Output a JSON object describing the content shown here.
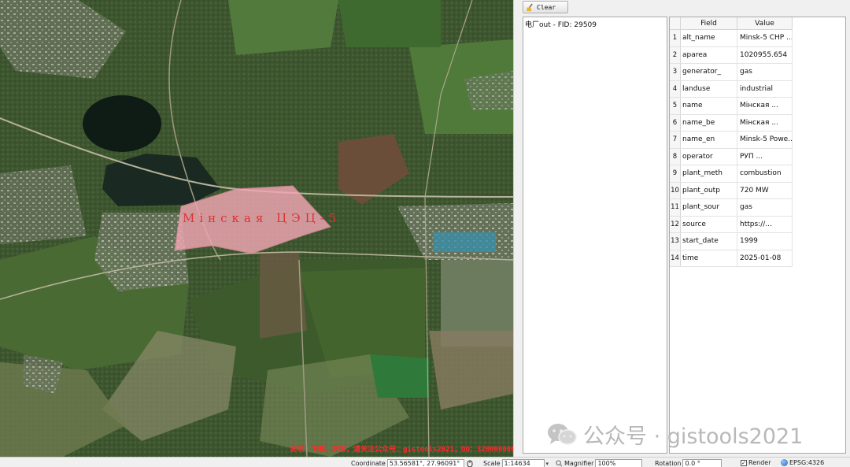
{
  "map": {
    "place_label": "Мінская ЦЭЦ-5",
    "watermark": "说明：下载、封装，请关注公众号：gistools2021，QQ：3200000000"
  },
  "identify_panel": {
    "clear_button": "Clear",
    "tree_item": "电厂out - FID: 29509"
  },
  "attribute_table": {
    "headers": {
      "field": "Field",
      "value": "Value"
    },
    "rows": [
      {
        "idx": "1",
        "field": "alt_name",
        "value": "Minsk-5 CHP ..."
      },
      {
        "idx": "2",
        "field": "aparea",
        "value": "1020955.654"
      },
      {
        "idx": "3",
        "field": "generator_",
        "value": "gas"
      },
      {
        "idx": "4",
        "field": "landuse",
        "value": "industrial"
      },
      {
        "idx": "5",
        "field": "name",
        "value": "Мінская ..."
      },
      {
        "idx": "6",
        "field": "name_be",
        "value": "Мінская ..."
      },
      {
        "idx": "7",
        "field": "name_en",
        "value": "Minsk-5 Powe..."
      },
      {
        "idx": "8",
        "field": "operator",
        "value": "РУП ..."
      },
      {
        "idx": "9",
        "field": "plant_meth",
        "value": "combustion"
      },
      {
        "idx": "10",
        "field": "plant_outp",
        "value": "720 MW"
      },
      {
        "idx": "11",
        "field": "plant_sour",
        "value": "gas"
      },
      {
        "idx": "12",
        "field": "source",
        "value": "https://..."
      },
      {
        "idx": "13",
        "field": "start_date",
        "value": "1999"
      },
      {
        "idx": "14",
        "field": "time",
        "value": "2025-01-08"
      }
    ]
  },
  "watermark_brand": {
    "text": "公众号 · gistools2021"
  },
  "status_bar": {
    "coordinate_label": "Coordinate",
    "coordinate_value": "53.56581°, 27.96091°",
    "scale_label": "Scale",
    "scale_value": "1:14634",
    "magnifier_label": "Magnifier",
    "magnifier_value": "100%",
    "rotation_label": "Rotation",
    "rotation_value": "0.0 °",
    "render_label": "Render",
    "crs_label": "EPSG:4326"
  },
  "colors": {
    "plant_fill": "#f2a7b4",
    "label_red": "#dd3333",
    "panel_bg": "#f0f0f0"
  }
}
